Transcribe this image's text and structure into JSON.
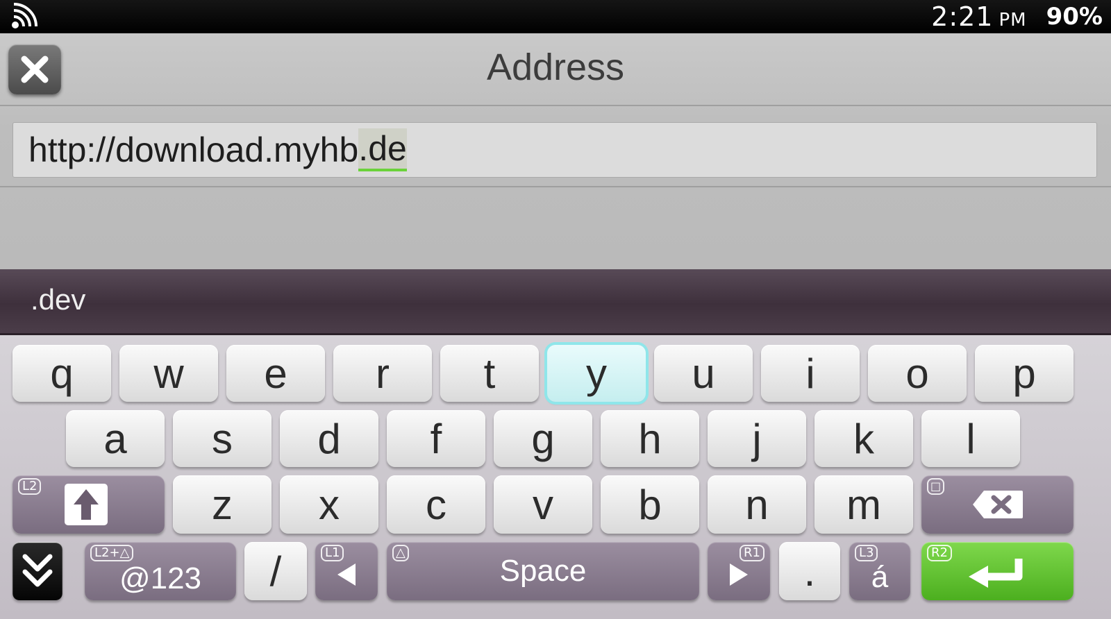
{
  "status_bar": {
    "wifi_icon": "wifi-icon",
    "time": "2:21",
    "ampm": "PM",
    "battery": "90%"
  },
  "dialog": {
    "title": "Address",
    "close_icon": "close-icon",
    "address_prefix": "http://download.myhb",
    "address_selected": ".de"
  },
  "suggestions": [
    ".dev"
  ],
  "keyboard": {
    "row1": [
      "q",
      "w",
      "e",
      "r",
      "t",
      "y",
      "u",
      "i",
      "o",
      "p"
    ],
    "row2": [
      "a",
      "s",
      "d",
      "f",
      "g",
      "h",
      "j",
      "k",
      "l"
    ],
    "row3": [
      "z",
      "x",
      "c",
      "v",
      "b",
      "n",
      "m"
    ],
    "selected_key": "y",
    "shift_hint": "L2",
    "shift_icon": "shift-arrow-icon",
    "backspace_hint": "□",
    "backspace_icon": "backspace-icon",
    "hide_icon": "chevron-down-icon",
    "num_hint": "L2+△",
    "num_label": "@123",
    "slash_label": "/",
    "left_hint": "L1",
    "left_icon": "cursor-left-icon",
    "space_hint": "△",
    "space_label": "Space",
    "right_hint": "R1",
    "right_icon": "cursor-right-icon",
    "dot_label": ".",
    "accent_hint": "L3",
    "accent_label": "á",
    "enter_hint": "R2",
    "enter_icon": "enter-icon",
    "accent_color": "#5cc22b",
    "selection_color": "#8fe6ea"
  }
}
